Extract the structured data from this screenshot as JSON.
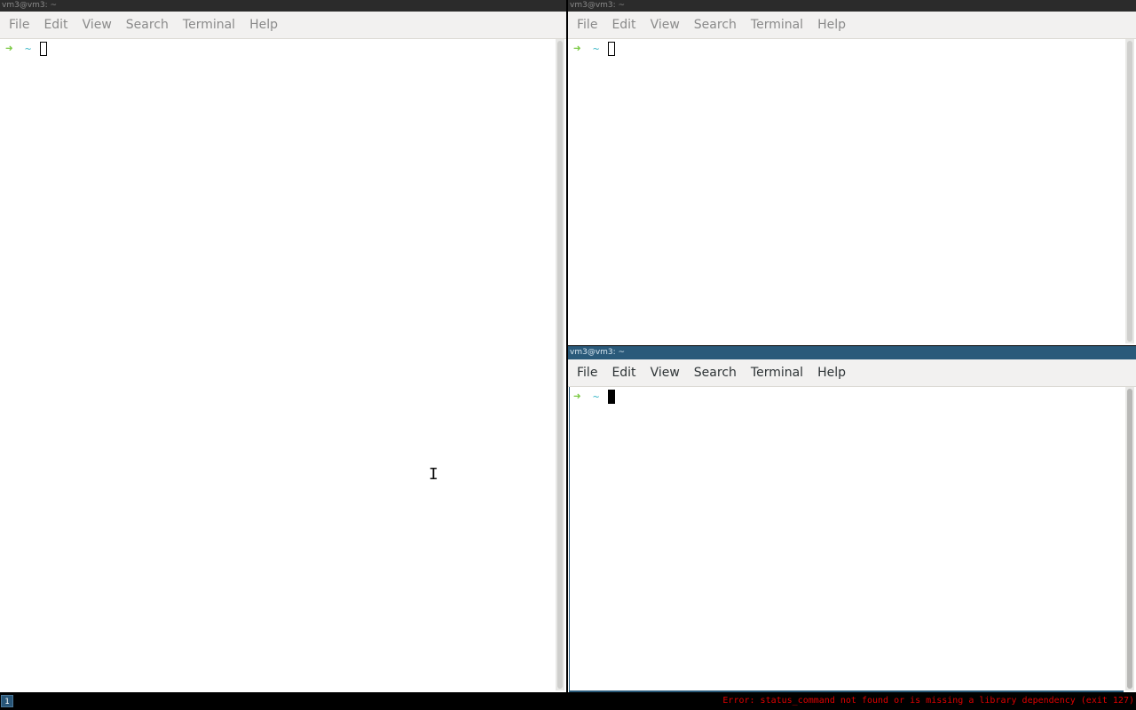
{
  "windows": {
    "left": {
      "title": "vm3@vm3: ~",
      "menu": [
        "File",
        "Edit",
        "View",
        "Search",
        "Terminal",
        "Help"
      ],
      "prompt": {
        "arrow_icon": "right-arrow-icon",
        "dir": "~"
      }
    },
    "top_right": {
      "title": "vm3@vm3: ~",
      "menu": [
        "File",
        "Edit",
        "View",
        "Search",
        "Terminal",
        "Help"
      ],
      "prompt": {
        "arrow_icon": "right-arrow-icon",
        "dir": "~"
      }
    },
    "bottom_right": {
      "title": "vm3@vm3: ~",
      "menu": [
        "File",
        "Edit",
        "View",
        "Search",
        "Terminal",
        "Help"
      ],
      "prompt": {
        "arrow_icon": "right-arrow-icon",
        "dir": "~"
      },
      "focused": true
    }
  },
  "statusbar": {
    "workspace": "1",
    "error": "Error: status_command not found or is missing a library dependency (exit 127)"
  },
  "colors": {
    "prompt_arrow": "#7ac943",
    "prompt_dir": "#3fb8c8",
    "focused_border": "#2a5a7a",
    "error_text": "#e00000"
  }
}
